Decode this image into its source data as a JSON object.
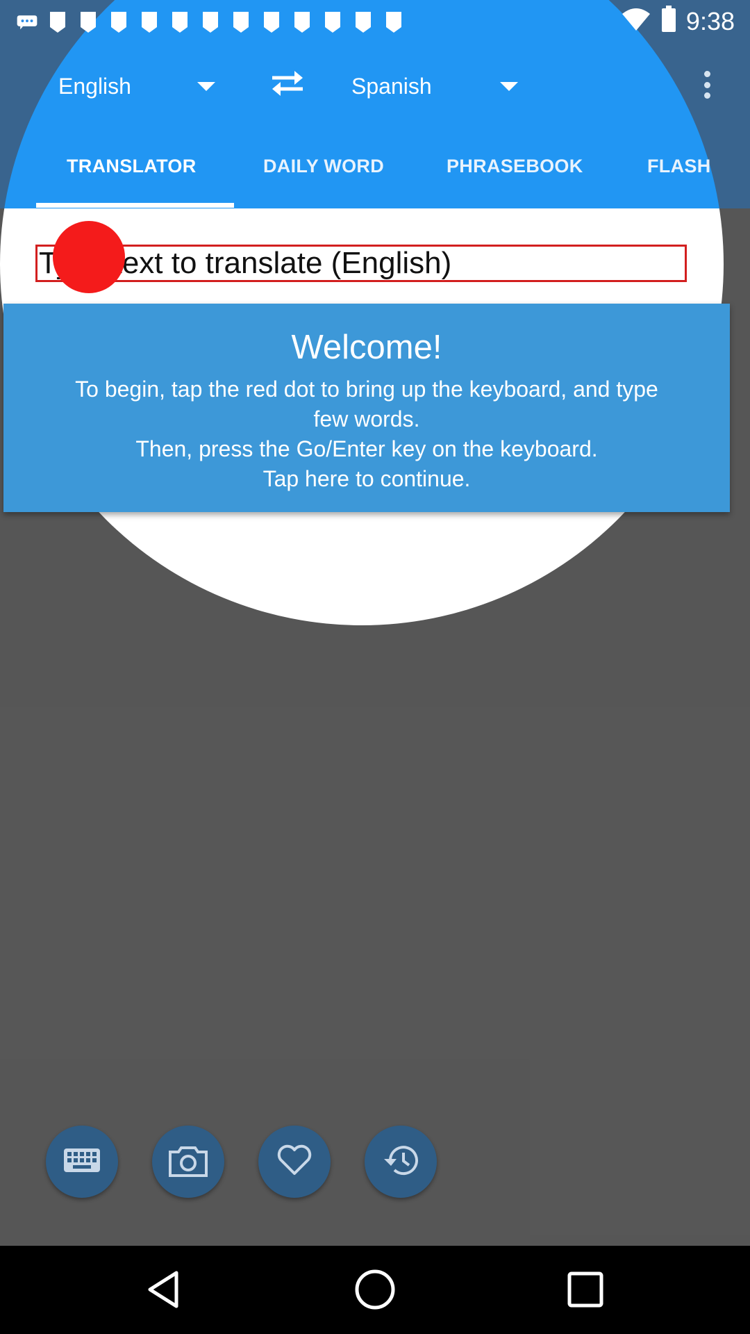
{
  "status_bar": {
    "time": "9:38",
    "left_icons": [
      "chat-bubble-icon",
      "notification-icon",
      "notification-icon",
      "notification-icon",
      "notification-icon",
      "notification-icon",
      "notification-icon",
      "notification-icon",
      "notification-icon",
      "notification-icon",
      "notification-icon",
      "notification-icon",
      "notification-icon"
    ],
    "right_icons": [
      "wifi-icon",
      "battery-icon"
    ]
  },
  "toolbar": {
    "source_language": "English",
    "target_language": "Spanish",
    "swap_icon": "swap-arrows-icon",
    "menu_icon": "more-vert-icon"
  },
  "tabs": [
    {
      "label": "TRANSLATOR",
      "active": true
    },
    {
      "label": "DAILY WORD",
      "active": false
    },
    {
      "label": "PHRASEBOOK",
      "active": false
    },
    {
      "label": "FLASH",
      "active": false
    }
  ],
  "input": {
    "placeholder": "Type text to translate (English)"
  },
  "tutorial": {
    "title": "Welcome!",
    "lines": [
      "To begin, tap the red dot to bring up the keyboard, and type",
      "few words.",
      "Then, press the Go/Enter key on the keyboard.",
      "Tap here to continue."
    ]
  },
  "actions": [
    {
      "icon": "keyboard-icon"
    },
    {
      "icon": "camera-icon"
    },
    {
      "icon": "heart-icon"
    },
    {
      "icon": "history-icon"
    }
  ],
  "nav_bar": {
    "icons": [
      "back-icon",
      "home-icon",
      "recents-icon"
    ]
  },
  "colors": {
    "app_bar": "#2196f3",
    "highlight_dot": "#f41b1b",
    "card": "#3d98d8",
    "fab": "#2f5d86"
  }
}
